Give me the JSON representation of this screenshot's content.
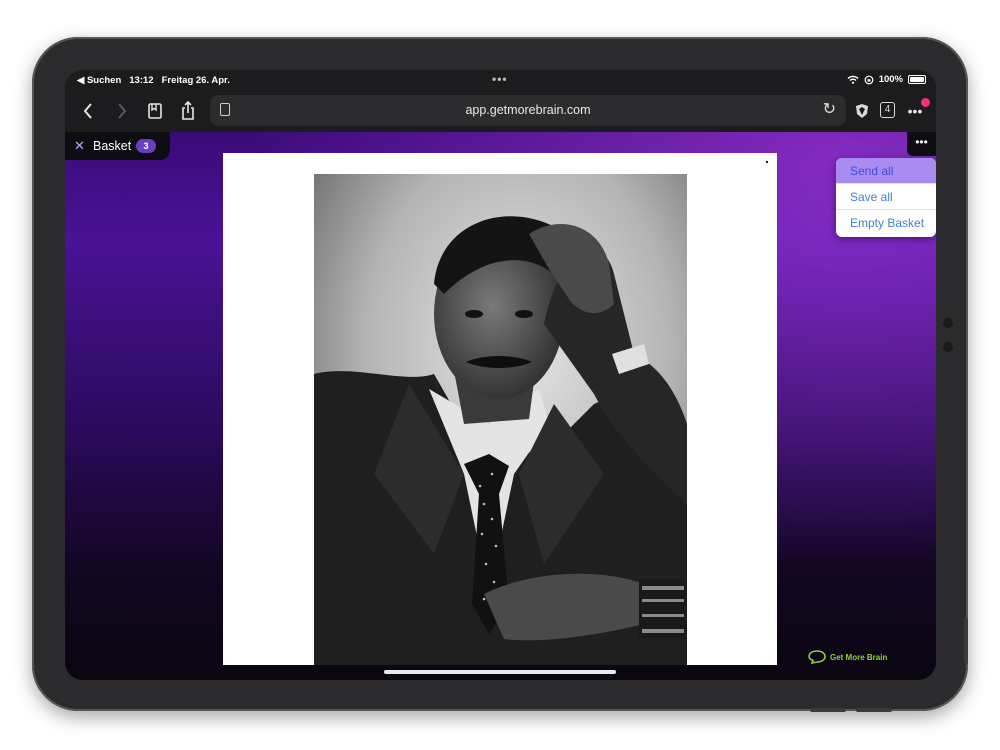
{
  "status_bar": {
    "back_app": "◀ Suchen",
    "time": "13:12",
    "date": "Freitag 26. Apr.",
    "battery_text": "100%",
    "battery_level": 1.0
  },
  "browser": {
    "url": "app.getmorebrain.com",
    "tab_count": "4"
  },
  "basket": {
    "label": "Basket",
    "count": "3"
  },
  "menu": {
    "items": [
      "Send all",
      "Save all",
      "Empty Basket"
    ],
    "active_item": "Send all"
  },
  "brand": {
    "name": "Get More Brain"
  },
  "colors": {
    "accent_purple": "#6a3fc4",
    "menu_highlight": "#a98cf0",
    "link_blue": "#3b82d6",
    "brand_green": "#8ad43a",
    "notification_pink": "#ff2d78"
  }
}
